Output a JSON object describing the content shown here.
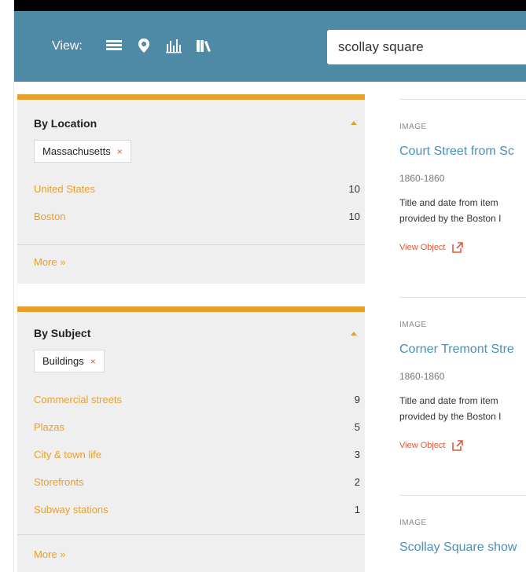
{
  "header": {
    "view_label": "View:",
    "search_value": "scollay square",
    "view_icons": [
      "list-view-icon",
      "map-view-icon",
      "timeline-view-icon",
      "shelf-view-icon"
    ]
  },
  "colors": {
    "accent": "#e8a02d",
    "header_bg": "#4e8aa5",
    "link": "#4a90b8",
    "view_object": "#e05a3a"
  },
  "facets": [
    {
      "title": "By Location",
      "selected": "Massachusetts",
      "items": [
        {
          "label": "United States",
          "count": "10"
        },
        {
          "label": "Boston",
          "count": "10"
        }
      ],
      "more": "More »"
    },
    {
      "title": "By Subject",
      "selected": "Buildings",
      "items": [
        {
          "label": "Commercial streets",
          "count": "9"
        },
        {
          "label": "Plazas",
          "count": "5"
        },
        {
          "label": "City & town life",
          "count": "3"
        },
        {
          "label": "Storefronts",
          "count": "2"
        },
        {
          "label": "Subway stations",
          "count": "1"
        }
      ],
      "more": "More »"
    }
  ],
  "results": [
    {
      "type": "IMAGE",
      "title": "Court Street from Sc",
      "date": "1860-1860",
      "desc_line1": "Title and date from item",
      "desc_line2": "provided by the Boston I",
      "link": "View Object"
    },
    {
      "type": "IMAGE",
      "title": "Corner Tremont Stre",
      "date": "1860-1860",
      "desc_line1": "Title and date from item",
      "desc_line2": "provided by the Boston I",
      "link": "View Object"
    },
    {
      "type": "IMAGE",
      "title": "Scollay Square show",
      "date": "",
      "desc_line1": "",
      "desc_line2": "",
      "link": ""
    }
  ]
}
